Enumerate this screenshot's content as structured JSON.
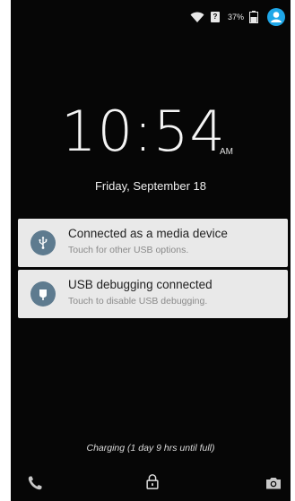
{
  "status_bar": {
    "sim_label": "?",
    "battery_percent": "37%"
  },
  "lockscreen": {
    "time": "10:54",
    "ampm": "AM",
    "date": "Friday, September 18",
    "charging_text": "Charging (1 day 9 hrs until full)"
  },
  "notifications": [
    {
      "title": "Connected as a media device",
      "subtitle": "Touch for other USB options.",
      "icon": "usb-icon"
    },
    {
      "title": "USB debugging connected",
      "subtitle": "Touch to disable USB debugging.",
      "icon": "debug-icon"
    }
  ],
  "icons": {
    "bottom_left": "phone-icon",
    "bottom_center": "lock-icon",
    "bottom_right": "camera-icon"
  },
  "colors": {
    "background": "#060606",
    "notification_bg": "#e9e9e9",
    "notification_icon_bg": "#5e7b8f",
    "accent_user": "#1fa7e8"
  }
}
